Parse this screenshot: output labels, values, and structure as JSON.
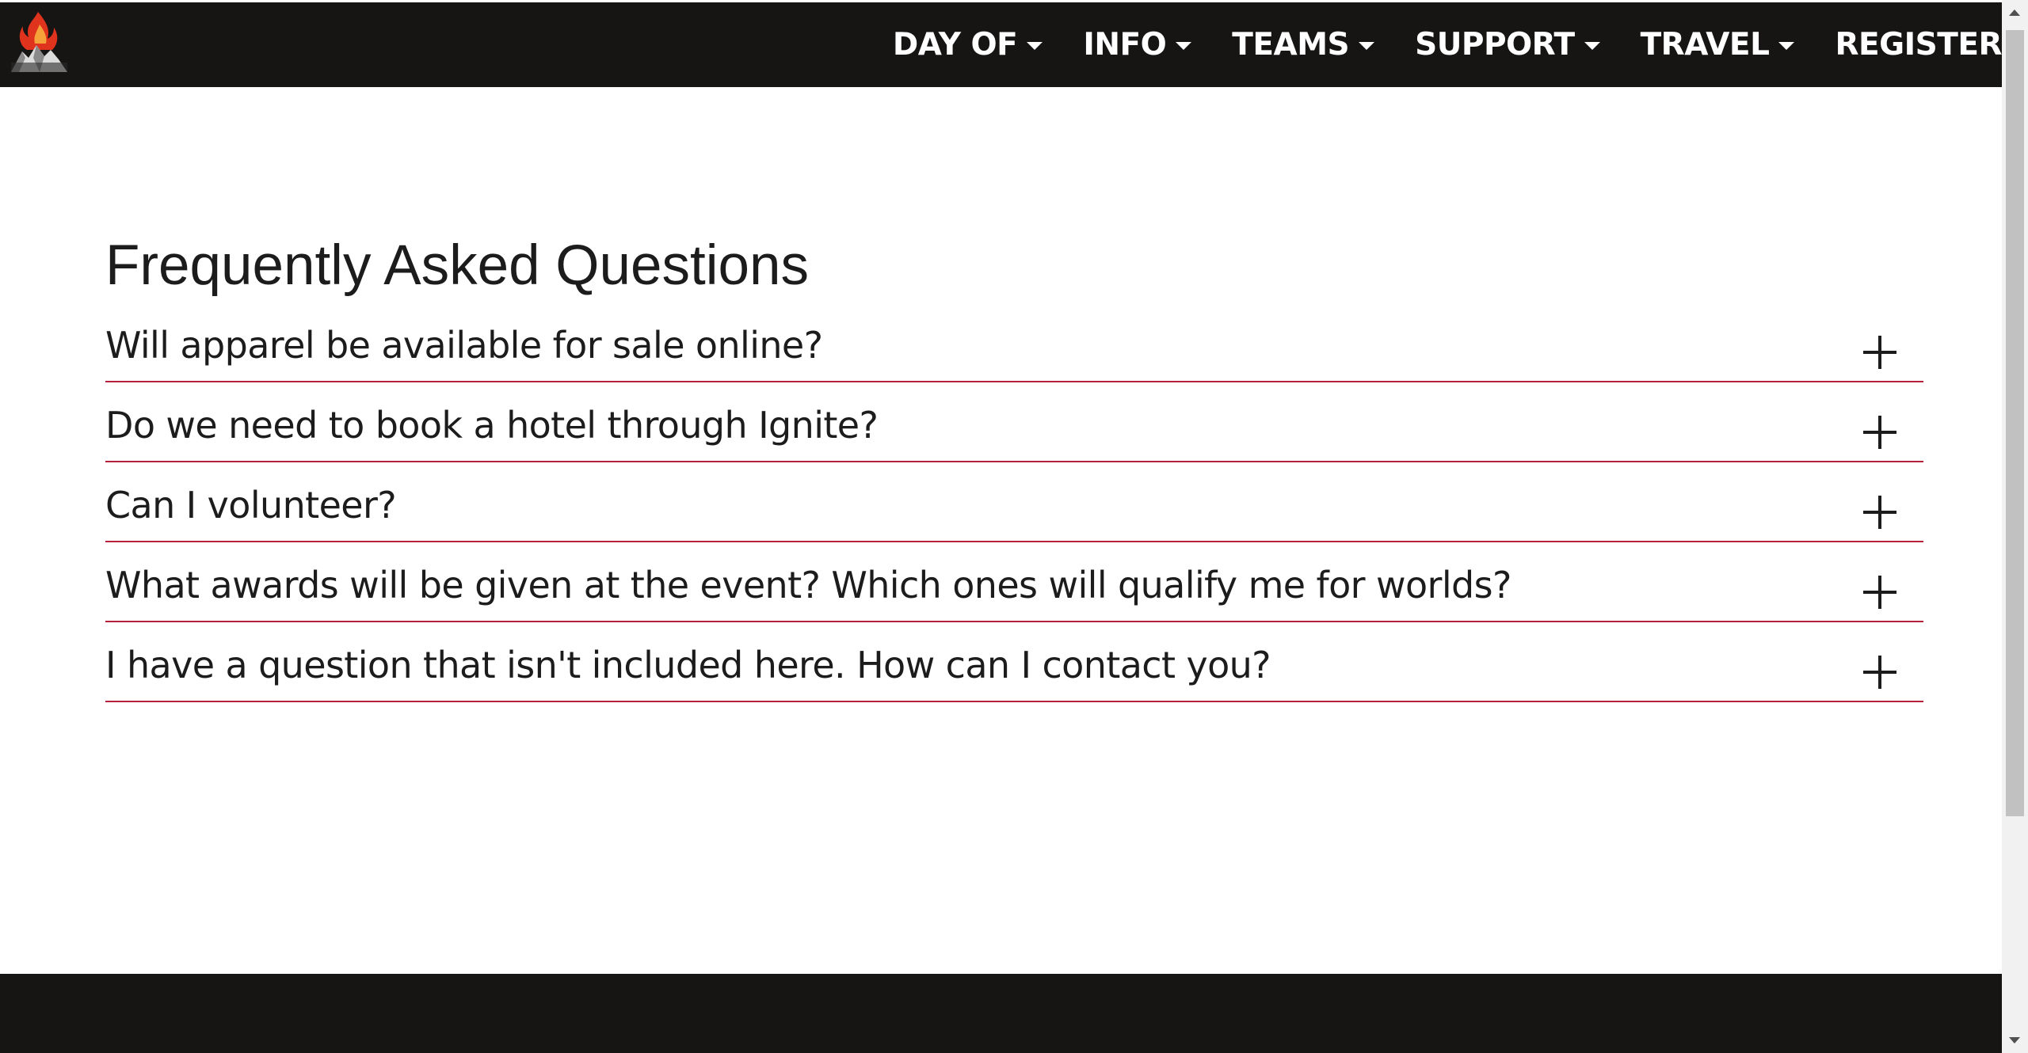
{
  "nav": {
    "logo_icon": "flame-mountain-logo-icon",
    "items": [
      {
        "label": "DAY OF",
        "has_dropdown": true
      },
      {
        "label": "INFO",
        "has_dropdown": true
      },
      {
        "label": "TEAMS",
        "has_dropdown": true
      },
      {
        "label": "SUPPORT",
        "has_dropdown": true
      },
      {
        "label": "TRAVEL",
        "has_dropdown": true
      },
      {
        "label": "REGISTER",
        "has_dropdown": false
      }
    ]
  },
  "faq": {
    "title": "Frequently Asked Questions",
    "expand_icon": "plus-icon",
    "questions": [
      "Will apparel be available for sale online?",
      "Do we need to book a hotel through Ignite?",
      "Can I volunteer?",
      "What awards will be given at the event? Which ones will qualify me for worlds?",
      "I have a question that isn't included here. How can I contact you?"
    ]
  },
  "colors": {
    "navbar_bg": "#171514",
    "divider": "#b5213a",
    "text": "#1c1c1c"
  }
}
